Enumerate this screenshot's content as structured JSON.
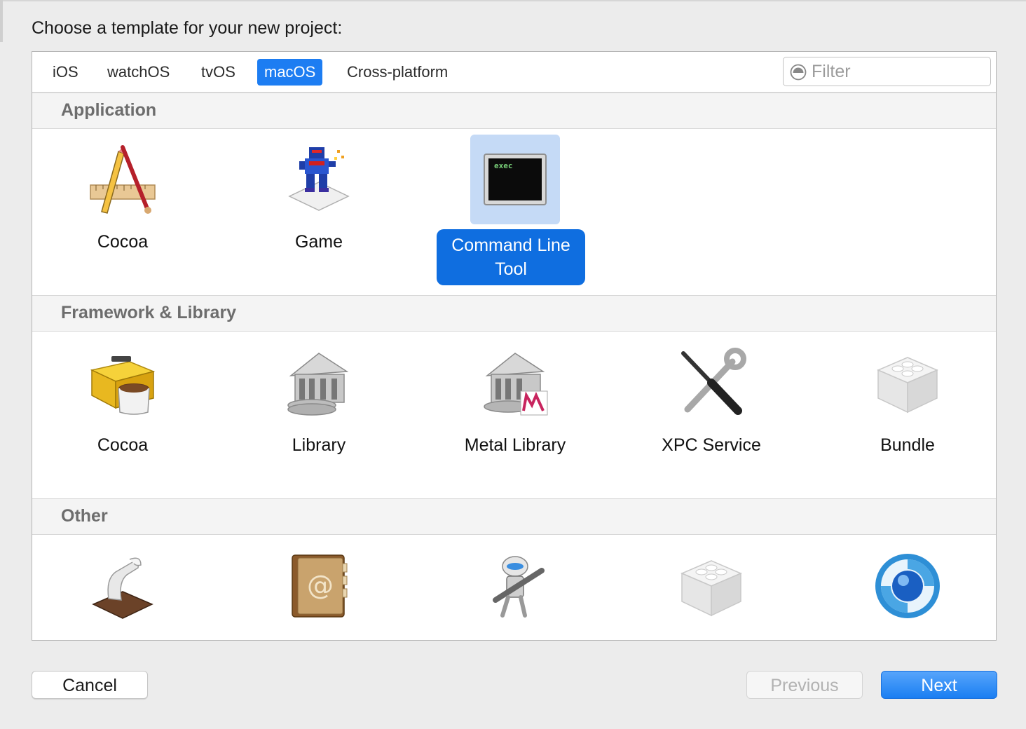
{
  "prompt": "Choose a template for your new project:",
  "tabs": [
    {
      "label": "iOS",
      "active": false
    },
    {
      "label": "watchOS",
      "active": false
    },
    {
      "label": "tvOS",
      "active": false
    },
    {
      "label": "macOS",
      "active": true
    },
    {
      "label": "Cross-platform",
      "active": false
    }
  ],
  "filter": {
    "placeholder": "Filter",
    "value": ""
  },
  "sections": [
    {
      "title": "Application",
      "items": [
        {
          "label": "Cocoa",
          "icon": "cocoa-app-icon"
        },
        {
          "label": "Game",
          "icon": "game-icon"
        },
        {
          "label": "Command Line Tool",
          "icon": "terminal-icon",
          "icon_text": "exec",
          "selected": true
        }
      ]
    },
    {
      "title": "Framework & Library",
      "items": [
        {
          "label": "Cocoa",
          "icon": "cocoa-framework-icon"
        },
        {
          "label": "Library",
          "icon": "library-icon"
        },
        {
          "label": "Metal Library",
          "icon": "metal-library-icon"
        },
        {
          "label": "XPC Service",
          "icon": "xpc-service-icon"
        },
        {
          "label": "Bundle",
          "icon": "bundle-icon"
        }
      ]
    },
    {
      "title": "Other",
      "items": [
        {
          "label": "",
          "icon": "applescript-icon"
        },
        {
          "label": "",
          "icon": "address-book-icon"
        },
        {
          "label": "",
          "icon": "automator-icon"
        },
        {
          "label": "",
          "icon": "plugin-icon"
        },
        {
          "label": "",
          "icon": "sync-icon"
        }
      ]
    }
  ],
  "buttons": {
    "cancel": "Cancel",
    "previous": "Previous",
    "next": "Next"
  },
  "colors": {
    "accent": "#1d7df2",
    "selection_bg": "#c5daf6",
    "selected_label": "#0f6ee0"
  }
}
